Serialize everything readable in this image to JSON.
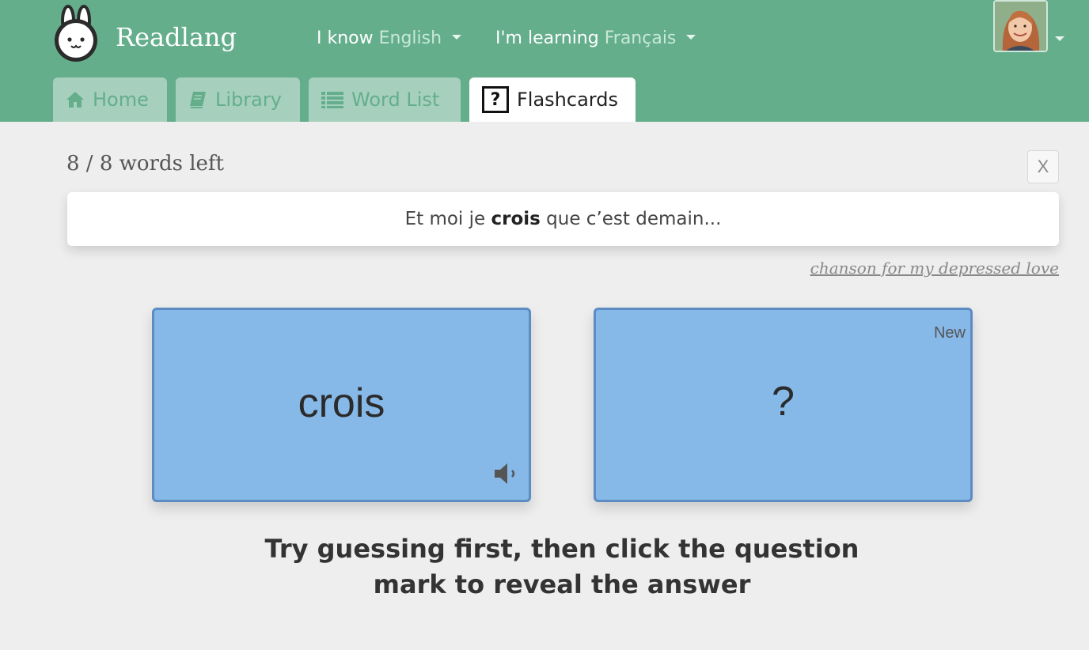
{
  "header": {
    "brand": "Readlang",
    "known_label": "I know",
    "known_value": "English",
    "learning_label": "I'm learning",
    "learning_value": "Français"
  },
  "tabs": [
    {
      "label": "Home",
      "icon": "home-icon"
    },
    {
      "label": "Library",
      "icon": "book-icon"
    },
    {
      "label": "Word List",
      "icon": "list-icon"
    },
    {
      "label": "Flashcards",
      "icon": "question-box-icon",
      "active": true
    }
  ],
  "flashcards": {
    "words_left": "8 / 8 words left",
    "close_label": "X",
    "sentence_before": "Et moi je",
    "sentence_word": "crois",
    "sentence_after": "que c’est demain...",
    "source": "chanson for my depressed love",
    "front_word": "crois",
    "back_text": "?",
    "badge": "New",
    "hint": "Try guessing first, then click the question mark to reveal the answer"
  },
  "colors": {
    "header": "#64ae8c",
    "tab_inactive": "#a6d0bd",
    "card": "#86b9e8",
    "card_border": "#5d8cc2",
    "background": "#eeeeee"
  }
}
